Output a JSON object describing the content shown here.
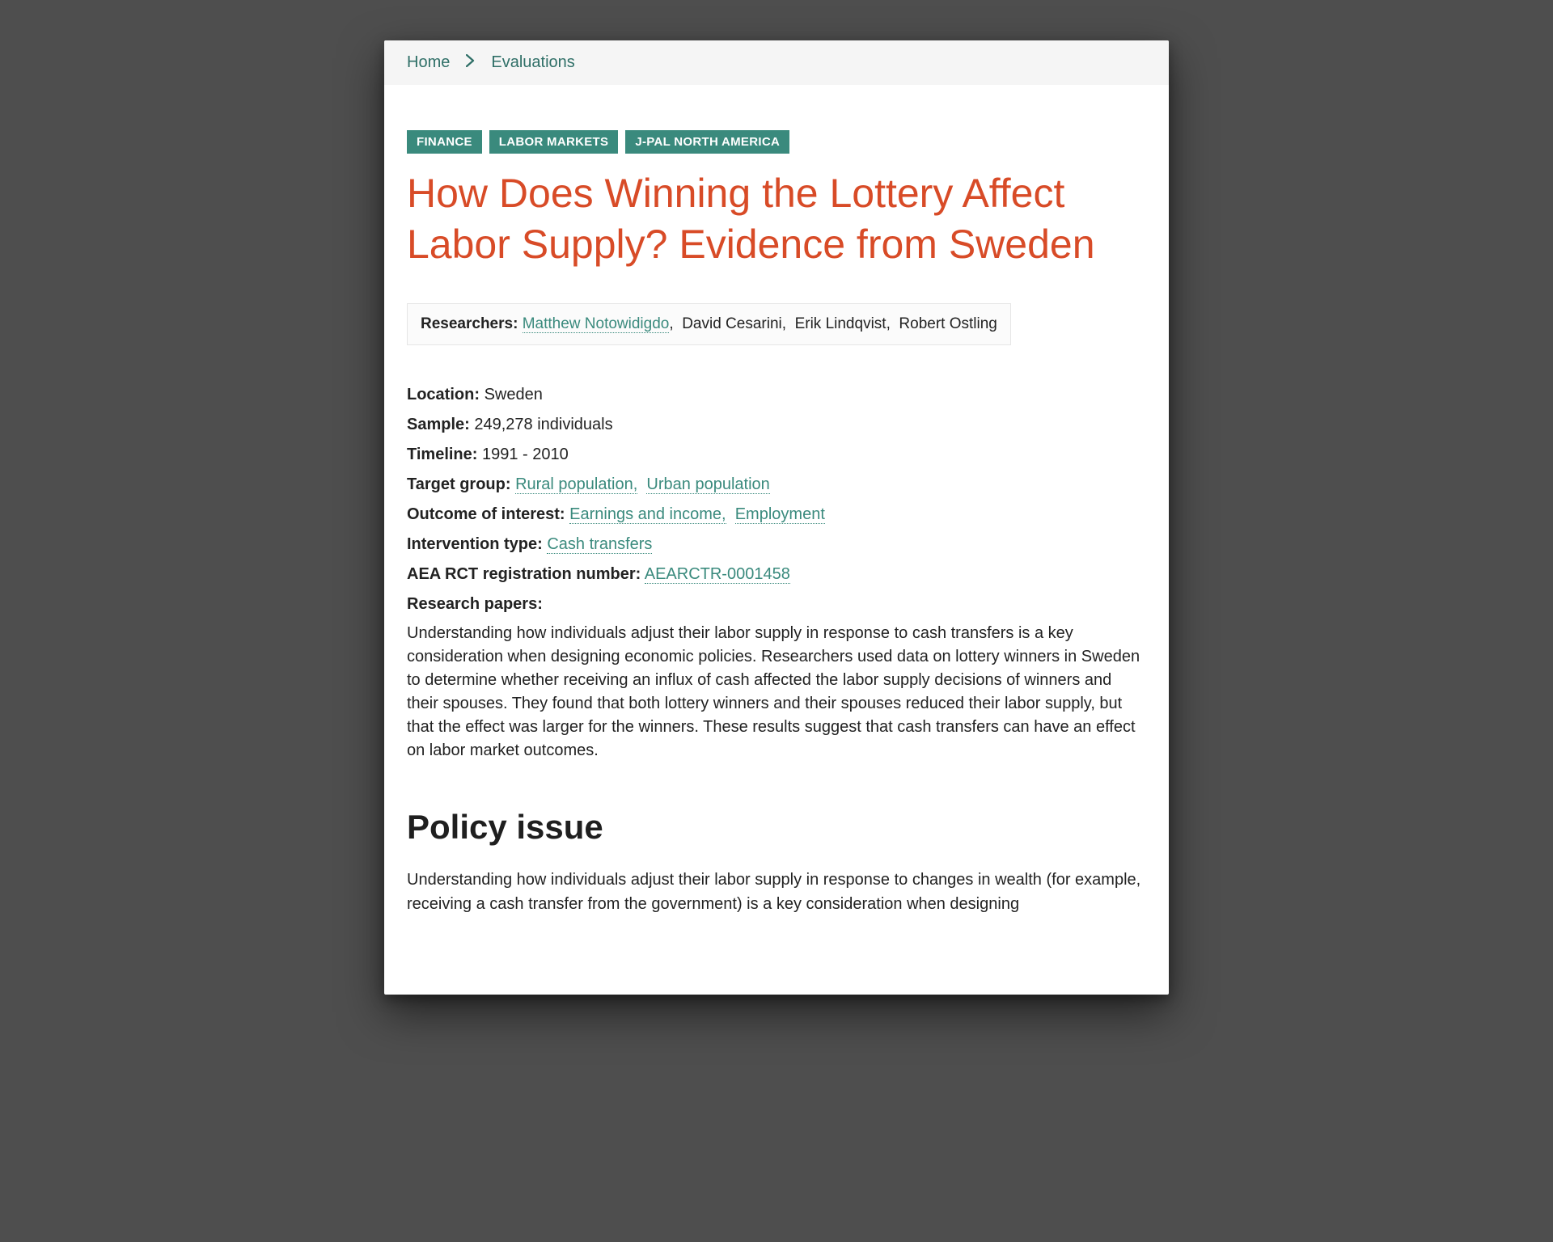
{
  "breadcrumb": {
    "home": "Home",
    "evaluations": "Evaluations"
  },
  "tags": [
    "FINANCE",
    "LABOR MARKETS",
    "J-PAL NORTH AMERICA"
  ],
  "title": "How Does Winning the Lottery Affect Labor Supply? Evidence from Sweden",
  "researchers": {
    "label": "Researchers:",
    "linked": "Matthew Notowidigdo",
    "others": ",  David Cesarini,  Erik Lindqvist,  Robert Ostling"
  },
  "meta": {
    "location_label": "Location:",
    "location": "Sweden",
    "sample_label": "Sample:",
    "sample": "249,278 individuals",
    "timeline_label": "Timeline:",
    "timeline": "1991 - 2010",
    "target_label": "Target group:",
    "target1": "Rural population,",
    "target2": "Urban population",
    "outcome_label": "Outcome of interest:",
    "outcome1": "Earnings and income,",
    "outcome2": "Employment",
    "intervention_label": "Intervention type:",
    "intervention1": "Cash transfers",
    "aea_label": "AEA RCT registration number:",
    "aea": "AEARCTR-0001458",
    "papers_label": "Research papers:"
  },
  "summary": "Understanding how individuals adjust their labor supply in response to cash transfers is a key consideration when designing economic policies. Researchers used data on lottery winners in Sweden to determine whether receiving an influx of cash affected the labor supply decisions of winners and their spouses. They found that both lottery winners and their spouses reduced their labor supply, but that the effect was larger for the winners. These results suggest that cash transfers can have an effect on labor market outcomes.",
  "section1_heading": "Policy issue",
  "section1_body": "Understanding how individuals adjust their labor supply in response to changes in wealth (for example, receiving a cash transfer from the government) is a key consideration when designing"
}
